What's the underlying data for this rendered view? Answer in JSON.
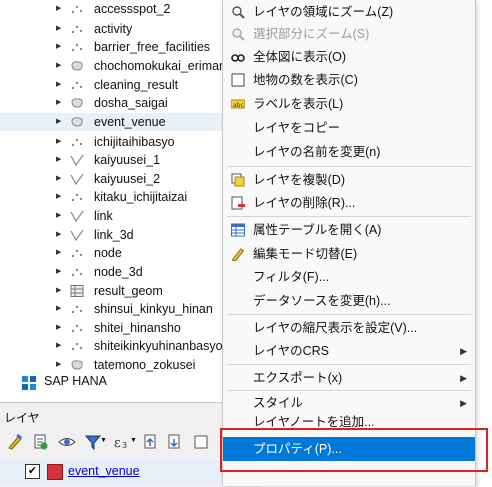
{
  "browser_tree": {
    "items": [
      {
        "label": "accessspot_2",
        "icon": "point-layer-icon"
      },
      {
        "label": "activity",
        "icon": "point-layer-icon"
      },
      {
        "label": "barrier_free_facilities",
        "icon": "point-layer-icon"
      },
      {
        "label": "chochomokukai_erimar",
        "icon": "polygon-layer-icon"
      },
      {
        "label": "cleaning_result",
        "icon": "point-layer-icon"
      },
      {
        "label": "dosha_saigai",
        "icon": "polygon-layer-icon"
      },
      {
        "label": "event_venue",
        "icon": "polygon-layer-icon"
      },
      {
        "label": "ichijitaihibasyo",
        "icon": "point-layer-icon"
      },
      {
        "label": "kaiyuusei_1",
        "icon": "line-layer-icon"
      },
      {
        "label": "kaiyuusei_2",
        "icon": "line-layer-icon"
      },
      {
        "label": "kitaku_ichijitaizai",
        "icon": "point-layer-icon"
      },
      {
        "label": "link",
        "icon": "line-layer-icon"
      },
      {
        "label": "link_3d",
        "icon": "line-layer-icon"
      },
      {
        "label": "node",
        "icon": "point-layer-icon"
      },
      {
        "label": "node_3d",
        "icon": "point-layer-icon"
      },
      {
        "label": "result_geom",
        "icon": "table-layer-icon"
      },
      {
        "label": "shinsui_kinkyu_hinan",
        "icon": "point-layer-icon"
      },
      {
        "label": "shitei_hinansho",
        "icon": "point-layer-icon"
      },
      {
        "label": "shiteikinkyuhinanbasyo",
        "icon": "point-layer-icon"
      },
      {
        "label": "tatemono_zokusei",
        "icon": "polygon-layer-icon"
      }
    ],
    "sap_hana": "SAP HANA"
  },
  "layers_panel": {
    "title": "レイヤ",
    "layer_name": "event_venue"
  },
  "context_menu": {
    "items": [
      {
        "label": "レイヤの領域にズーム(Z)",
        "icon": "zoom-layer-icon"
      },
      {
        "label": "選択部分にズーム(S)",
        "icon": "zoom-selection-icon"
      },
      {
        "label": "全体図に表示(O)",
        "icon": "overview-icon"
      },
      {
        "label": "地物の数を表示(C)",
        "icon": "checkbox-icon"
      },
      {
        "label": "ラベルを表示(L)",
        "icon": "label-icon"
      },
      {
        "label": "レイヤをコピー",
        "icon": ""
      },
      {
        "label": "レイヤの名前を変更(n)",
        "icon": ""
      },
      {
        "label": "レイヤを複製(D)",
        "icon": "duplicate-icon"
      },
      {
        "label": "レイヤの削除(R)...",
        "icon": "remove-icon"
      },
      {
        "label": "属性テーブルを開く(A)",
        "icon": "table-icon"
      },
      {
        "label": "編集モード切替(E)",
        "icon": "pencil-icon"
      },
      {
        "label": "フィルタ(F)...",
        "icon": ""
      },
      {
        "label": "データソースを変更(h)...",
        "icon": ""
      },
      {
        "label": "レイヤの縮尺表示を設定(V)...",
        "icon": ""
      },
      {
        "label": "レイヤのCRS",
        "icon": ""
      },
      {
        "label": "エクスポート(x)",
        "icon": ""
      },
      {
        "label": "スタイル",
        "icon": ""
      },
      {
        "label": "レイヤノートを追加...",
        "icon": ""
      },
      {
        "label": "プロパティ(P)...",
        "icon": ""
      }
    ],
    "highlight_color": "#0078d7",
    "annotation_color": "#e0201c"
  }
}
